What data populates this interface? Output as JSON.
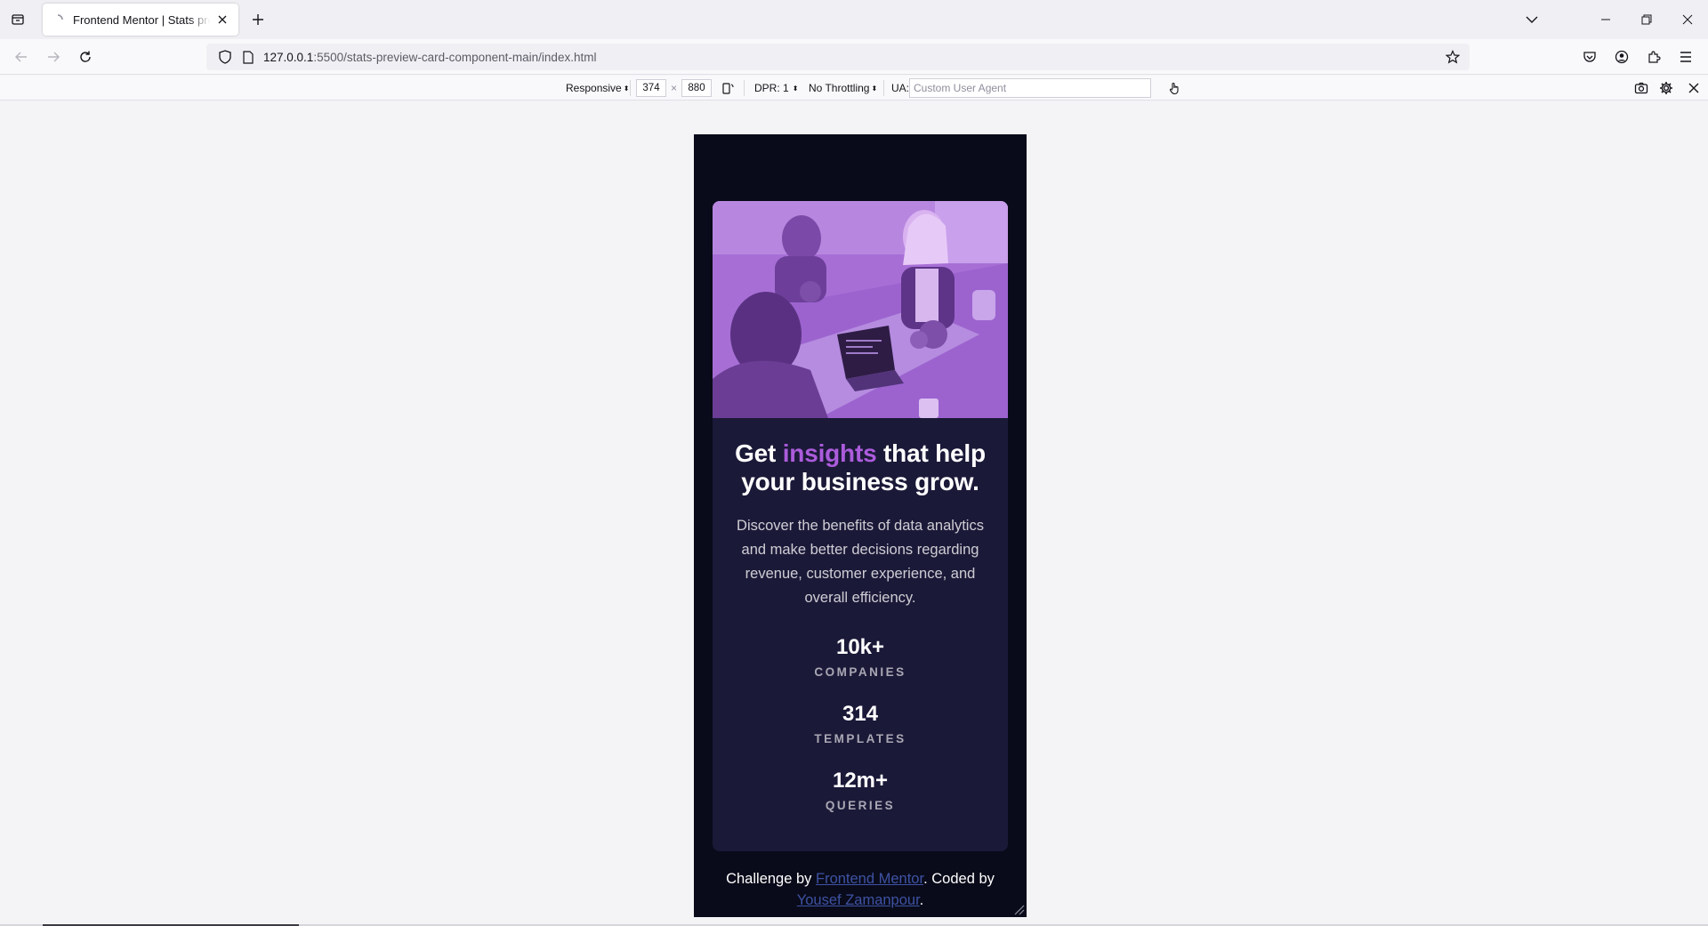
{
  "browser": {
    "tab_title": "Frontend Mentor | Stats preview card component",
    "url_host": "127.0.0.1",
    "url_path": ":5500/stats-preview-card-component-main/index.html"
  },
  "rdm": {
    "device": "Responsive",
    "width": "374",
    "times": "×",
    "height": "880",
    "dpr": "DPR: 1",
    "throttling": "No Throttling",
    "ua_label": "UA:",
    "ua_placeholder": "Custom User Agent"
  },
  "card": {
    "headline_before": "Get ",
    "headline_accent": "insights",
    "headline_after": " that help your business grow.",
    "description": "Discover the benefits of data analytics and make better decisions regarding revenue, customer experience, and overall efficiency.",
    "stats": [
      {
        "value": "10k+",
        "label": "COMPANIES"
      },
      {
        "value": "314",
        "label": "TEMPLATES"
      },
      {
        "value": "12m+",
        "label": "QUERIES"
      }
    ]
  },
  "attribution": {
    "prefix": "Challenge by ",
    "link1": "Frontend Mentor",
    "middle": ". Coded by",
    "link2": "Yousef Zamanpour",
    "suffix": "."
  },
  "colors": {
    "page_bg": "#090b1a",
    "card_bg": "#1b1938",
    "accent": "#ab5cdb",
    "image_tint": "#a668dc"
  }
}
